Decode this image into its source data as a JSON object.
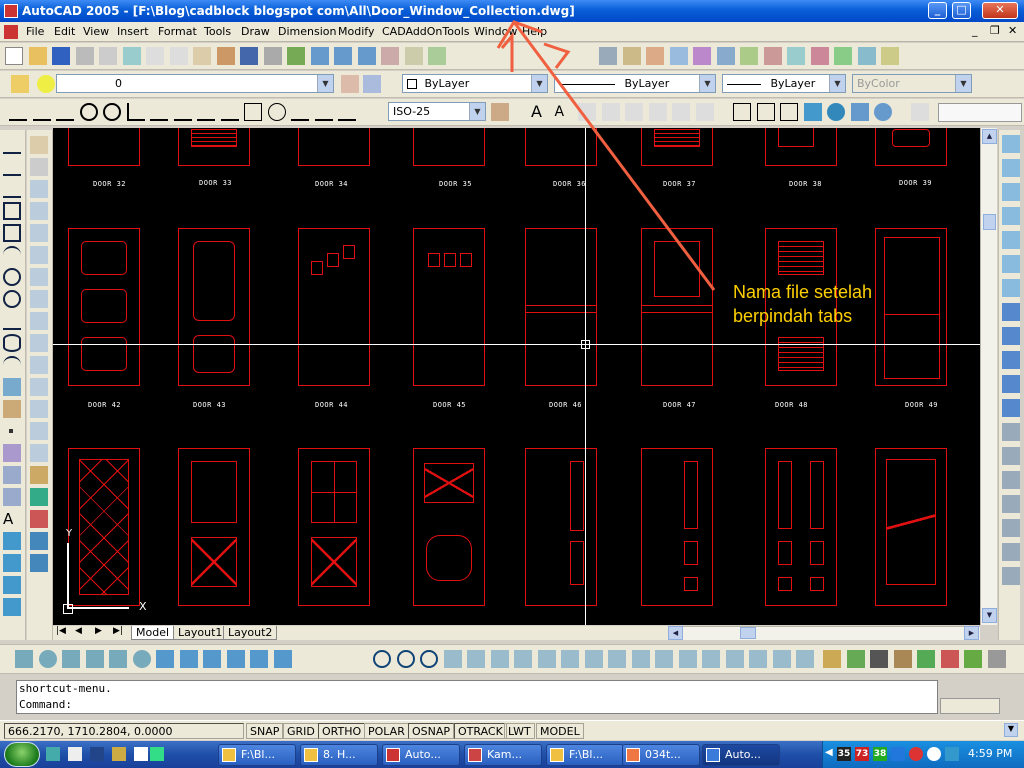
{
  "titlebar": {
    "title": "AutoCAD 2005 - [F:\\Blog\\cadblock blogspot com\\All\\Door_Window_Collection.dwg]",
    "min": "_",
    "max": "□",
    "close": "✕"
  },
  "menu": [
    "File",
    "Edit",
    "View",
    "Insert",
    "Format",
    "Tools",
    "Draw",
    "Dimension",
    "Modify",
    "CADAddOnTools",
    "Window",
    "Help"
  ],
  "layers": {
    "current_layer": "0",
    "color": "ByLayer",
    "linetype": "ByLayer",
    "lineweight": "ByLayer",
    "plotstyle": "ByColor"
  },
  "styles": {
    "dimstyle": "ISO-25"
  },
  "doors_row1": [
    "DOOR 32",
    "DOOR 33",
    "DOOR 34",
    "DOOR 35",
    "DOOR 36",
    "DOOR 37",
    "DOOR 38",
    "DOOR 39"
  ],
  "doors_row2": [
    "DOOR 42",
    "DOOR 43",
    "DOOR 44",
    "DOOR 45",
    "DOOR 46",
    "DOOR 47",
    "DOOR 48",
    "DOOR 49"
  ],
  "ucs": {
    "x": "X",
    "y": "Y"
  },
  "tabs": [
    "Model",
    "Layout1",
    "Layout2"
  ],
  "annotation": {
    "line1": "Nama file setelah",
    "line2": "berpindah tabs"
  },
  "command": {
    "line1": "shortcut-menu.",
    "line2": "Command:"
  },
  "status": {
    "coords": "666.2170, 1710.2804, 0.0000",
    "toggles": [
      "SNAP",
      "GRID",
      "ORTHO",
      "POLAR",
      "OSNAP",
      "OTRACK",
      "LWT",
      "MODEL"
    ]
  },
  "taskbar": {
    "buttons": [
      "F:\\Bl...",
      "8. H...",
      "Auto...",
      "Kam...",
      "F:\\Bl...",
      "034t...",
      "Auto..."
    ],
    "tray": [
      "35",
      "73",
      "38"
    ],
    "clock": "4:59 PM"
  },
  "colors": {
    "cad_bg": "#000000",
    "door_line": "#e01010",
    "annotation": "#ffd000",
    "arrow": "#f06040"
  }
}
